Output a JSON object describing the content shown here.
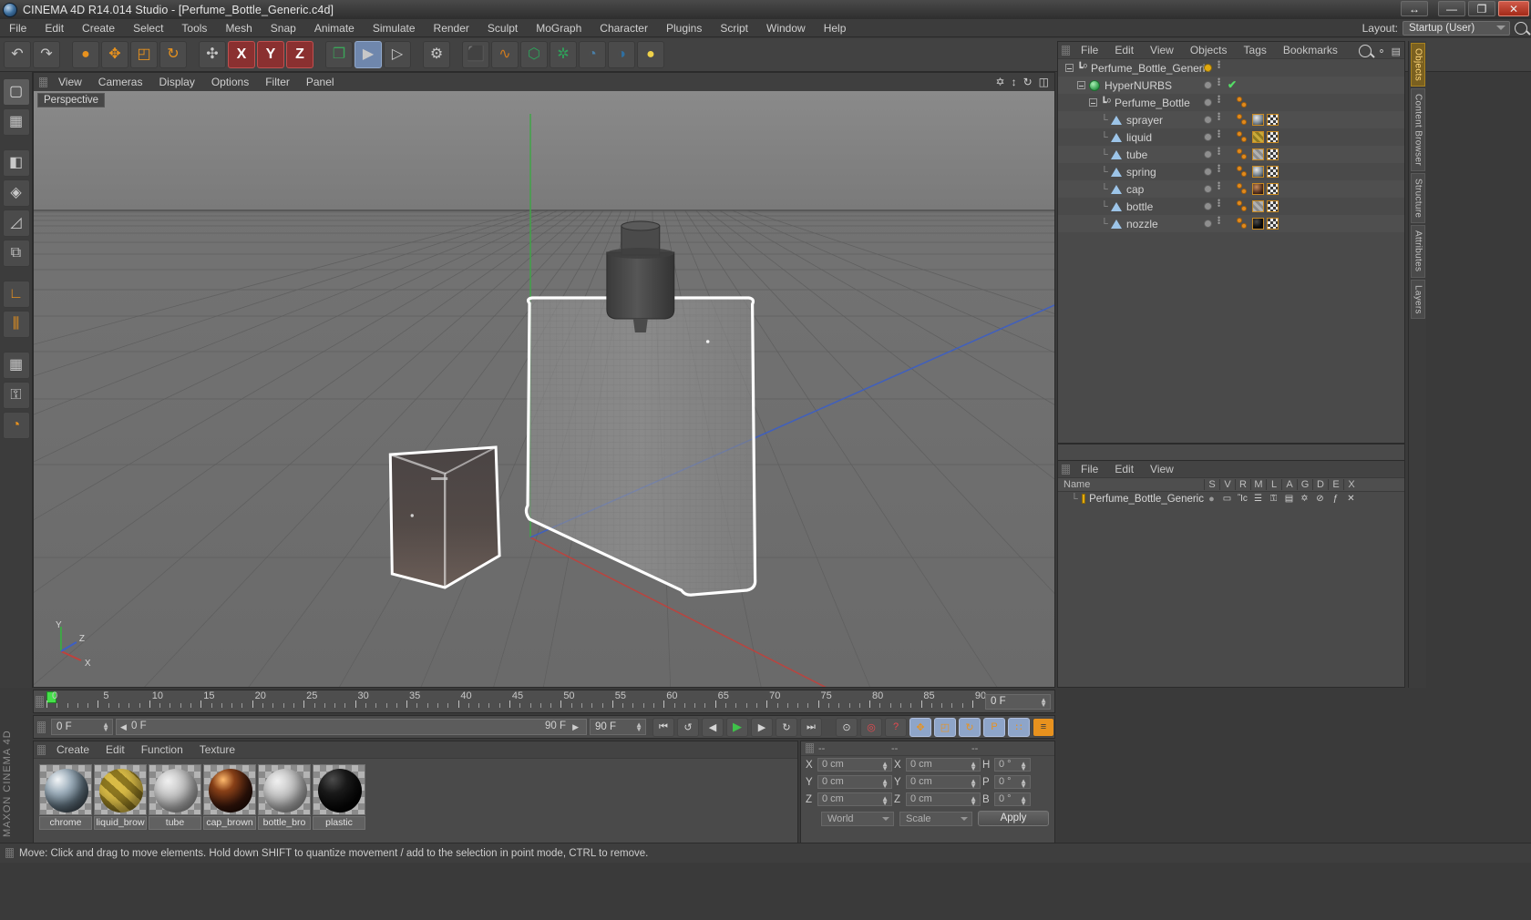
{
  "window": {
    "title": "CINEMA 4D R14.014 Studio - [Perfume_Bottle_Generic.c4d]",
    "restore_label": "↔",
    "minimize_label": "—",
    "maximize_label": "❐",
    "close_label": "✕"
  },
  "menu": {
    "items": [
      "File",
      "Edit",
      "Create",
      "Select",
      "Tools",
      "Mesh",
      "Snap",
      "Animate",
      "Simulate",
      "Render",
      "Sculpt",
      "MoGraph",
      "Character",
      "Plugins",
      "Script",
      "Window",
      "Help"
    ],
    "layout_label": "Layout:",
    "layout_value": "Startup (User)"
  },
  "toolbar": {
    "buttons": [
      {
        "name": "undo-button",
        "glyph": "↶"
      },
      {
        "name": "redo-button",
        "glyph": "↷"
      },
      {
        "name": "live-selection-tool",
        "glyph": "●"
      },
      {
        "name": "move-tool",
        "glyph": "✥"
      },
      {
        "name": "scale-tool",
        "glyph": "◰"
      },
      {
        "name": "rotate-tool",
        "glyph": "↻"
      },
      {
        "name": "world-object-axis-toggle",
        "glyph": "✣"
      },
      {
        "name": "lock-x-axis",
        "glyph": "X"
      },
      {
        "name": "lock-y-axis",
        "glyph": "Y"
      },
      {
        "name": "lock-z-axis",
        "glyph": "Z"
      },
      {
        "name": "world-coordinate-system",
        "glyph": "❐"
      },
      {
        "name": "render-view-button",
        "glyph": "▶"
      },
      {
        "name": "render-region-button",
        "glyph": "▷"
      },
      {
        "name": "render-settings-button",
        "glyph": "⚙"
      },
      {
        "name": "add-cube-object",
        "glyph": "⬛"
      },
      {
        "name": "add-spline-object",
        "glyph": "∿"
      },
      {
        "name": "add-generator-object",
        "glyph": "⬡"
      },
      {
        "name": "add-deformer-object",
        "glyph": "✲"
      },
      {
        "name": "add-scene-object",
        "glyph": "◑"
      },
      {
        "name": "add-camera-object",
        "glyph": "◎"
      },
      {
        "name": "add-light-object",
        "glyph": "Ὂ1"
      }
    ]
  },
  "left_tools": [
    {
      "name": "model-mode-tool",
      "glyph": "▢"
    },
    {
      "name": "texture-mode-tool",
      "glyph": "▦"
    },
    {
      "name": "polygon-mode-tool",
      "glyph": "◧"
    },
    {
      "name": "point-mode-tool",
      "glyph": "◈"
    },
    {
      "name": "edge-mode-tool",
      "glyph": "◿"
    },
    {
      "name": "object-axis-tool",
      "glyph": "⧉"
    },
    {
      "name": "workplane-tool",
      "glyph": "∟"
    },
    {
      "name": "snap-enable-tool",
      "glyph": "⫼"
    },
    {
      "name": "quantize-tool",
      "glyph": "▦"
    },
    {
      "name": "lock-workplane-tool",
      "glyph": "⚿"
    },
    {
      "name": "planar-workplane-tool",
      "glyph": "◔"
    }
  ],
  "branding": "MAXON CINEMA 4D",
  "viewport": {
    "menu": [
      "View",
      "Cameras",
      "Display",
      "Options",
      "Filter",
      "Panel"
    ],
    "label": "Perspective",
    "nav_icons": [
      "pan-view-icon",
      "dolly-view-icon",
      "rotate-view-icon",
      "maximize-view-icon"
    ],
    "axis_labels": [
      "Y",
      "Z",
      "X"
    ]
  },
  "object_manager": {
    "menu": [
      "File",
      "Edit",
      "View",
      "Objects",
      "Tags",
      "Bookmarks"
    ],
    "search_icon": "search-icon",
    "items": [
      {
        "label": "Perfume_Bottle_Generic",
        "depth": 0,
        "icon": "null-object-icon",
        "expander": true,
        "dot": "gold",
        "check": false,
        "tags": []
      },
      {
        "label": "HyperNURBS",
        "depth": 1,
        "icon": "hypernurbs-icon",
        "expander": true,
        "dot": "grey",
        "check": true,
        "tags": []
      },
      {
        "label": "Perfume_Bottle",
        "depth": 2,
        "icon": "null-object-icon",
        "expander": true,
        "dot": "grey",
        "check": false,
        "tags": [
          "phong"
        ]
      },
      {
        "label": "sprayer",
        "depth": 3,
        "icon": "polygon-object-icon",
        "expander": false,
        "dot": "grey",
        "check": false,
        "tags": [
          "phong",
          "material-chrome",
          "uvw"
        ]
      },
      {
        "label": "liquid",
        "depth": 3,
        "icon": "polygon-object-icon",
        "expander": false,
        "dot": "grey",
        "check": false,
        "tags": [
          "phong",
          "material-liquid",
          "uvw"
        ]
      },
      {
        "label": "tube",
        "depth": 3,
        "icon": "polygon-object-icon",
        "expander": false,
        "dot": "grey",
        "check": false,
        "tags": [
          "phong",
          "material-tube",
          "uvw"
        ]
      },
      {
        "label": "spring",
        "depth": 3,
        "icon": "polygon-object-icon",
        "expander": false,
        "dot": "grey",
        "check": false,
        "tags": [
          "phong",
          "material-chrome",
          "uvw"
        ]
      },
      {
        "label": "cap",
        "depth": 3,
        "icon": "polygon-object-icon",
        "expander": false,
        "dot": "grey",
        "check": false,
        "tags": [
          "phong",
          "material-cap",
          "uvw"
        ]
      },
      {
        "label": "bottle",
        "depth": 3,
        "icon": "polygon-object-icon",
        "expander": false,
        "dot": "grey",
        "check": false,
        "tags": [
          "phong",
          "material-bottle",
          "uvw"
        ]
      },
      {
        "label": "nozzle",
        "depth": 3,
        "icon": "polygon-object-icon",
        "expander": false,
        "dot": "grey",
        "check": false,
        "tags": [
          "phong",
          "material-plastic",
          "uvw"
        ]
      }
    ]
  },
  "layers_manager": {
    "menu": [
      "File",
      "Edit",
      "View"
    ],
    "columns": [
      "Name",
      "S",
      "V",
      "R",
      "M",
      "L",
      "A",
      "G",
      "D",
      "E",
      "X"
    ],
    "rows": [
      {
        "name": "Perfume_Bottle_Generic",
        "color": "#e0a910",
        "icons": [
          "solo-dot-icon",
          "visible-icon",
          "render-icon",
          "manager-icon",
          "lock-icon",
          "animation-icon",
          "generator-icon",
          "deformer-icon",
          "expression-icon",
          "xref-icon"
        ]
      }
    ]
  },
  "timeline": {
    "labels": [
      "0",
      "5",
      "10",
      "15",
      "20",
      "25",
      "30",
      "35",
      "40",
      "45",
      "50",
      "55",
      "60",
      "65",
      "70",
      "75",
      "80",
      "85",
      "90"
    ],
    "start": 0,
    "end": 90,
    "current_frame_label": "0 F",
    "end_field": "0 F"
  },
  "transport": {
    "current_frame": "0 F",
    "range_start": "0 F",
    "range_end": "90 F",
    "preview_end": "90 F",
    "buttons": [
      {
        "name": "go-to-start-button",
        "glyph": "⏮"
      },
      {
        "name": "play-backwards-button",
        "glyph": "↺"
      },
      {
        "name": "step-back-button",
        "glyph": "◀"
      },
      {
        "name": "play-button",
        "glyph": "▶"
      },
      {
        "name": "step-forward-button",
        "glyph": "▶"
      },
      {
        "name": "play-forwards-button",
        "glyph": "↻"
      },
      {
        "name": "go-to-end-button",
        "glyph": "⏭"
      }
    ],
    "right_buttons": [
      {
        "name": "record-active-objects-button",
        "glyph": "⊙"
      },
      {
        "name": "autokeying-button",
        "glyph": "◎"
      },
      {
        "name": "keyframe-selection-button",
        "glyph": "?"
      },
      {
        "name": "position-key-button",
        "glyph": "✥"
      },
      {
        "name": "scale-key-button",
        "glyph": "◰"
      },
      {
        "name": "rotation-key-button",
        "glyph": "↻"
      },
      {
        "name": "param-key-button",
        "glyph": "P"
      },
      {
        "name": "point-level-animation-button",
        "glyph": "∷"
      },
      {
        "name": "timeline-toggle-button",
        "glyph": "≡"
      }
    ]
  },
  "material_manager": {
    "menu": [
      "Create",
      "Edit",
      "Function",
      "Texture"
    ],
    "materials": [
      {
        "name": "chrome",
        "label": "chrome",
        "style": "chrome"
      },
      {
        "name": "liquid_brown",
        "label": "liquid_brow",
        "style": "gold-stripe"
      },
      {
        "name": "tube",
        "label": "tube",
        "style": "glass"
      },
      {
        "name": "cap_brown",
        "label": "cap_brown",
        "style": "brown"
      },
      {
        "name": "bottle_brown",
        "label": "bottle_bro",
        "style": "glass"
      },
      {
        "name": "plastic",
        "label": "plastic",
        "style": "black"
      }
    ]
  },
  "coordinates": {
    "header": [
      "--",
      "--",
      "--"
    ],
    "position_label_group": [
      "X",
      "Y",
      "Z"
    ],
    "size_label_group": [
      "X",
      "Y",
      "Z"
    ],
    "rotation_label_group": [
      "H",
      "P",
      "B"
    ],
    "position": [
      "0 cm",
      "0 cm",
      "0 cm"
    ],
    "size": [
      "0 cm",
      "0 cm",
      "0 cm"
    ],
    "rotation": [
      "0 °",
      "0 °",
      "0 °"
    ],
    "coord_system": "World",
    "mode": "Scale",
    "apply_label": "Apply"
  },
  "dock_tabs": [
    {
      "label": "Objects",
      "active": true
    },
    {
      "label": "Content Browser",
      "active": false
    },
    {
      "label": "Structure",
      "active": false
    },
    {
      "label": "Attributes",
      "active": false
    },
    {
      "label": "Layers",
      "active": false
    }
  ],
  "status_bar": {
    "text": "Move: Click and drag to move elements. Hold down SHIFT to quantize movement / add to the selection in point mode, CTRL to remove."
  }
}
